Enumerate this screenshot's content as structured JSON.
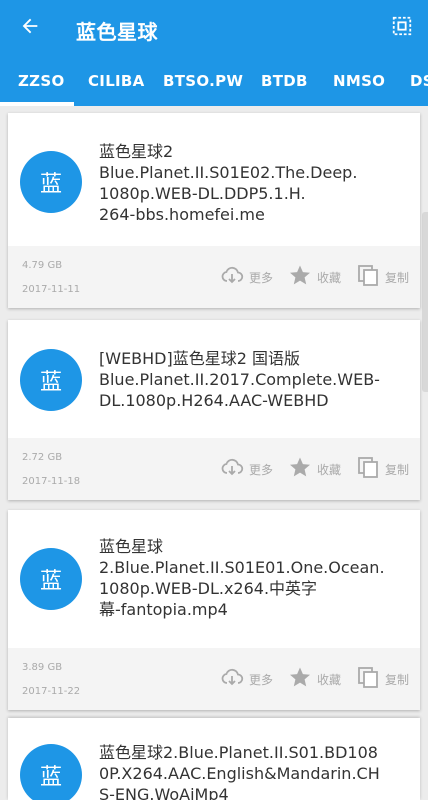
{
  "header": {
    "title": "蓝色星球",
    "back_icon": "arrow-back-icon",
    "select_icon": "select-all-icon",
    "color": "#1e96e6"
  },
  "tabs": [
    {
      "label": "ZZSO",
      "active": true
    },
    {
      "label": "CILIBA"
    },
    {
      "label": "BTSO.PW"
    },
    {
      "label": "BTDB"
    },
    {
      "label": "NMSO"
    },
    {
      "label": "DS"
    }
  ],
  "actions": {
    "more": "更多",
    "favorite": "收藏",
    "copy": "复制"
  },
  "results": [
    {
      "avatar": "蓝",
      "title": "蓝色星球2 Blue.Planet.II.S01E02.The.Deep.1080p.WEB-DL.DDP5.1.H.264-bbs.homefei.me",
      "lines": [
        "蓝色星球2",
        "Blue.Planet.II.S01E02.The.Deep.",
        "1080p.WEB-DL.DDP5.1.H.",
        "264-bbs.homefei.me"
      ],
      "size": "4.79 GB",
      "date": "2017-11-11"
    },
    {
      "avatar": "蓝",
      "lines": [
        "[WEBHD]蓝色星球2 国语版",
        "Blue.Planet.II.2017.Complete.WEB-",
        "DL.1080p.H264.AAC-WEBHD"
      ],
      "size": "2.72 GB",
      "date": "2017-11-18"
    },
    {
      "avatar": "蓝",
      "lines": [
        "蓝色星球",
        "2.Blue.Planet.II.S01E01.One.Ocean.",
        "1080p.WEB-DL.x264.中英字",
        "幕-fantopia.mp4"
      ],
      "size": "3.89 GB",
      "date": "2017-11-22"
    },
    {
      "avatar": "蓝",
      "lines": [
        "蓝色星球2.Blue.Planet.II.S01.BD108",
        "0P.X264.AAC.English&Mandarin.CH",
        "S-ENG.WoAiMp4"
      ],
      "size": "",
      "date": ""
    }
  ]
}
